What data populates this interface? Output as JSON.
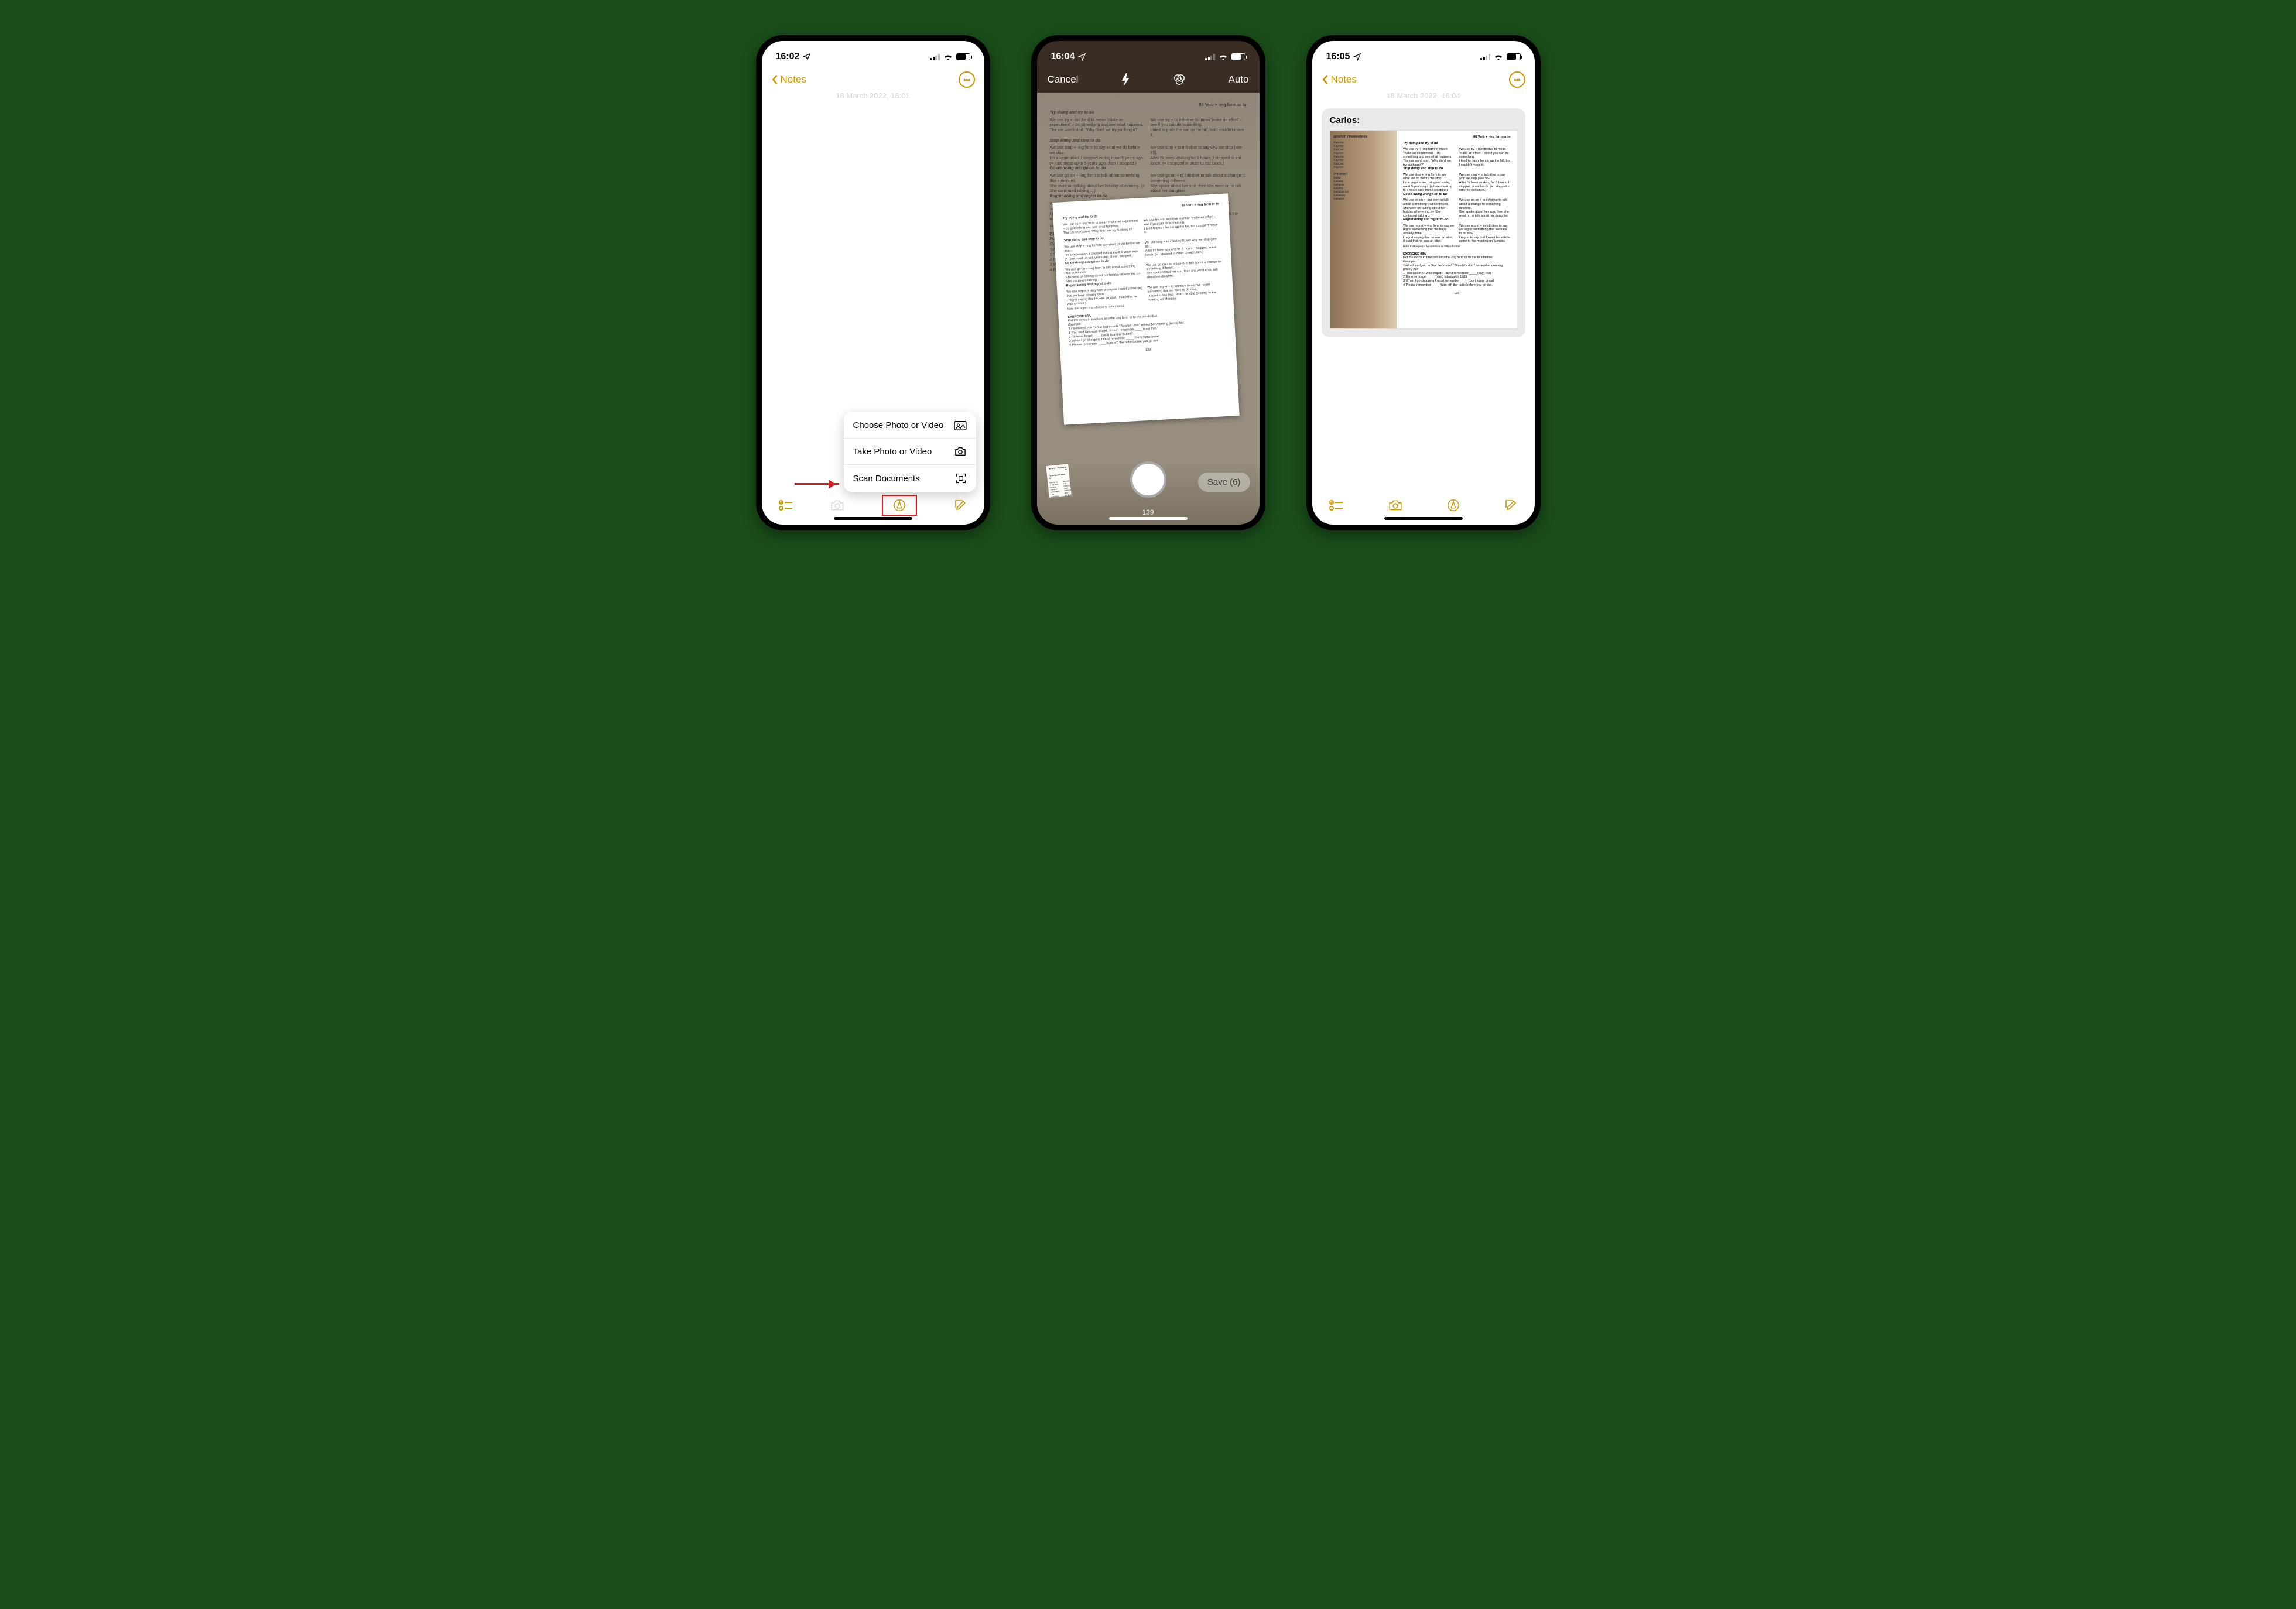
{
  "accent": "#c89600",
  "screen1": {
    "time": "16:02",
    "back": "Notes",
    "datestamp": "18 March 2022, 16:01",
    "menu": [
      {
        "label": "Choose Photo or Video",
        "icon": "photo"
      },
      {
        "label": "Take Photo or Video",
        "icon": "camera"
      },
      {
        "label": "Scan Documents",
        "icon": "scan"
      }
    ],
    "highlight": "Scan Documents"
  },
  "screen2": {
    "time": "16:04",
    "cancel": "Cancel",
    "mode": "Auto",
    "saveLabel": "Save (6)",
    "pageNumber": "139",
    "header": "88   Verb + -ing form or to",
    "sections": [
      {
        "title": "Try doing and try to do",
        "left": "We use try + -ing form to mean 'make an experiment' – do something and see what happens.\nThe car won't start.   'Why don't we try pushing it?'",
        "right": "We use try + to infinitive to mean 'make an effort' – see if you can do something.\nI tried to push the car up the hill, but I couldn't move it."
      },
      {
        "title": "Stop doing and stop to do",
        "left": "We use stop + -ing form to say what we do before we stop.\nI'm a vegetarian. I stopped eating meat 5 years ago. (= I ate meat up to 5 years ago, then I stopped.)",
        "right": "We use stop + to infinitive to say why we stop (see 95).\nAfter I'd been working for 3 hours, I stopped to eat lunch. (= I stopped in order to eat lunch.)"
      },
      {
        "title": "Go on doing and go on to do",
        "left": "We use go on + -ing form to talk about something that continues.\nShe went on talking about her holiday all evening. (= She continued talking …)",
        "right": "We use go on + to infinitive to talk about a change to something different.\nShe spoke about her son, then she went on to talk about her daughter."
      },
      {
        "title": "Regret doing and regret to do",
        "left": "We use regret + -ing form to say we regret something that we have already done.\nI regret saying that he was an idiot. (I said that he was an idiot.)",
        "right": "We use regret + to infinitive to say we regret something that we have to do now.\nI regret to say that I won't be able to come to the meeting on Monday."
      }
    ],
    "note": "Note that regret + to infinitive is rather formal.",
    "exercise": {
      "title": "EXERCISE 88A",
      "instr": "Put the verbs in brackets into the -ing form or to the to infinitive.",
      "example": "Example:\n'I introduced you to Sue last month.'   'Really! I don't remember meeting (meet) her.'",
      "items": [
        "'You said Ken was stupid.' 'I don't remember ____ (say) that.'",
        "I'll never forget ____ (visit) Istanbul in 1983.",
        "When I go shopping I must remember ____ (buy) some bread.",
        "Please remember ____ (turn off) the radio before you go out."
      ]
    }
  },
  "screen3": {
    "time": "16:05",
    "back": "Notes",
    "datestamp": "18 March 2022, 16:04",
    "attachTitle": "Carlos:",
    "leftPage": {
      "heading": "ДИАЛОГ. ГРАММАТИКА",
      "lines": [
        "Карина:",
        "Карлос:",
        "Карина:",
        "Карлос:",
        "Карина:",
        "Карлос:",
        "Карина:",
        "Карлос:"
      ],
      "subheading": "Pretérito I",
      "conj": [
        "bailar",
        "bailaba",
        "bailabas",
        "bailaba",
        "bailábamos",
        "bailabais",
        "bailaban"
      ]
    }
  }
}
